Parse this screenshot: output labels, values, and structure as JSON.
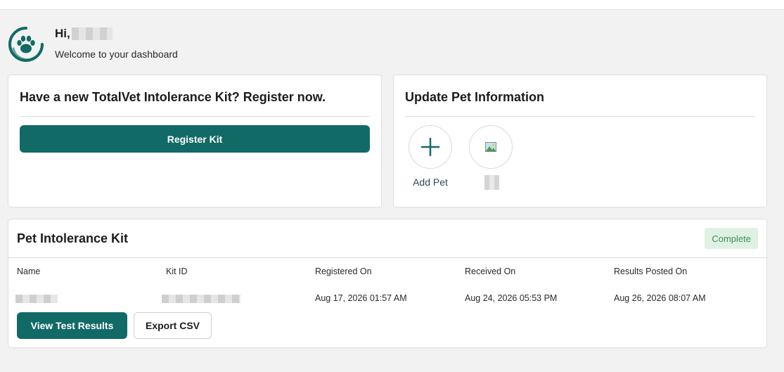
{
  "greeting": {
    "hi_label": "Hi,",
    "subtitle": "Welcome to your dashboard",
    "logo_icon": "paw-icon"
  },
  "kit_card": {
    "title": "Have a new TotalVet Intolerance Kit? Register now.",
    "register_button": "Register Kit"
  },
  "pets_card": {
    "title": "Update Pet Information",
    "add_pet_label": "Add Pet",
    "add_icon": "plus-icon",
    "pet_image_icon": "image-icon"
  },
  "results_card": {
    "title": "Pet Intolerance Kit",
    "status": "Complete",
    "columns": [
      "Name",
      "Kit ID",
      "Registered On",
      "Received On",
      "Results Posted On"
    ],
    "row": {
      "registered_on": "Aug 17, 2026 01:57 AM",
      "received_on": "Aug 24, 2026 05:53 PM",
      "results_posted_on": "Aug 26, 2026 08:07 AM"
    },
    "view_button": "View Test Results",
    "export_button": "Export CSV"
  },
  "colors": {
    "primary": "#126a66",
    "badge_bg": "#dff1e3",
    "badge_text": "#3c8f59",
    "page_bg": "#f2f2f2"
  }
}
